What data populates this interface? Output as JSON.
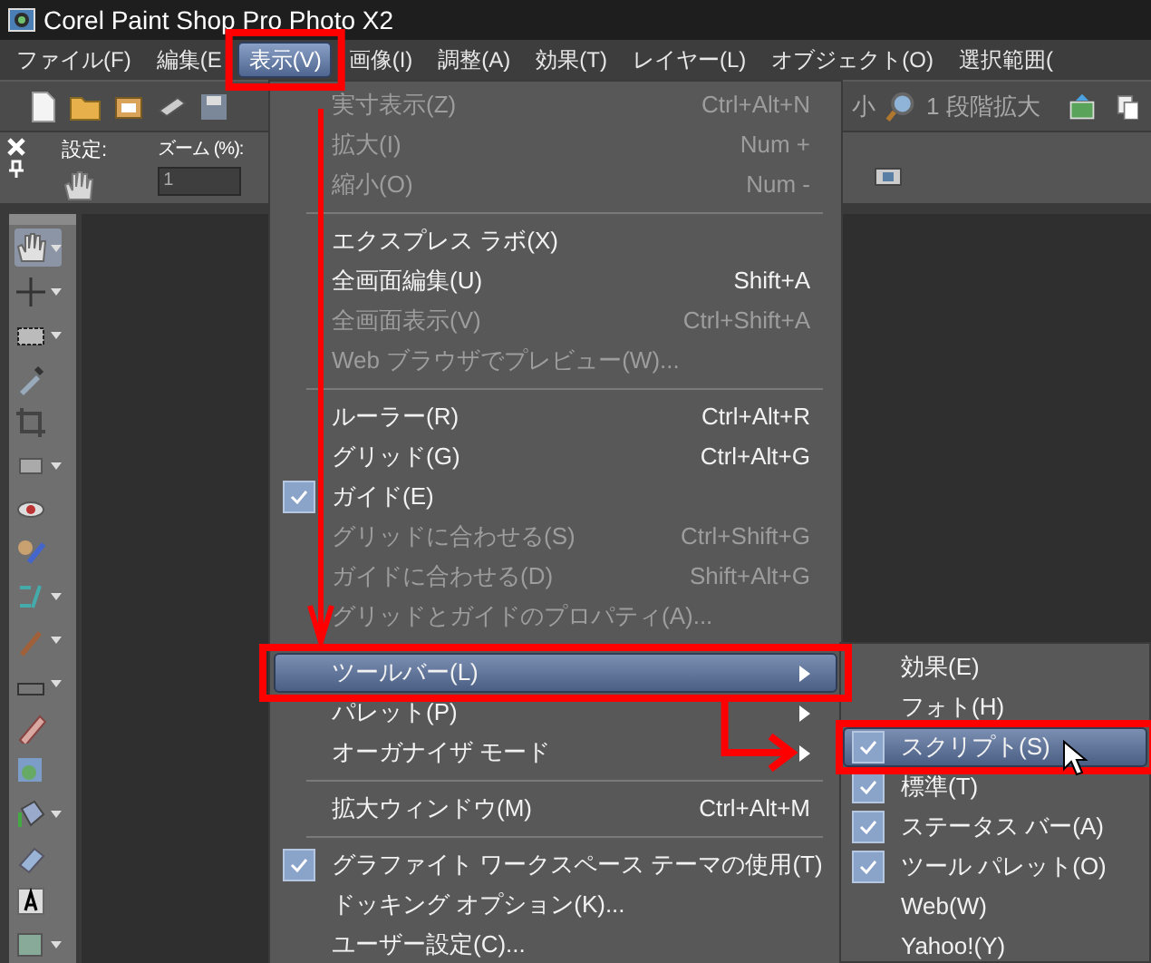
{
  "window": {
    "title": "Corel Paint Shop Pro Photo X2"
  },
  "menubar": [
    {
      "label": "ファイル(F)",
      "selected": false
    },
    {
      "label": "編集(E",
      "selected": false
    },
    {
      "label": "表示(V)",
      "selected": true
    },
    {
      "label": "画像(I)",
      "selected": false
    },
    {
      "label": "調整(A)",
      "selected": false
    },
    {
      "label": "効果(T)",
      "selected": false
    },
    {
      "label": "レイヤー(L)",
      "selected": false
    },
    {
      "label": "オブジェクト(O)",
      "selected": false
    },
    {
      "label": "選択範囲(",
      "selected": false
    }
  ],
  "toolbar": {
    "zoom_out_label": "小",
    "zoom_in_label": "1 段階拡大"
  },
  "tool_options": {
    "presets_label": "設定:",
    "zoom_label": "ズーム (%):",
    "zoom_value": "1"
  },
  "menu": [
    {
      "kind": "item",
      "label": "実寸表示(Z)",
      "shortcut": "Ctrl+Alt+N",
      "disabled": true,
      "checked": false,
      "selected": false,
      "submenu": false
    },
    {
      "kind": "item",
      "label": "拡大(I)",
      "shortcut": "Num +",
      "disabled": true,
      "checked": false,
      "selected": false,
      "submenu": false
    },
    {
      "kind": "item",
      "label": "縮小(O)",
      "shortcut": "Num -",
      "disabled": true,
      "checked": false,
      "selected": false,
      "submenu": false
    },
    {
      "kind": "separator"
    },
    {
      "kind": "item",
      "label": "エクスプレス ラボ(X)",
      "disabled": false,
      "checked": false,
      "selected": false,
      "submenu": false
    },
    {
      "kind": "item",
      "label": "全画面編集(U)",
      "shortcut": "Shift+A",
      "disabled": false,
      "checked": false,
      "selected": false,
      "submenu": false
    },
    {
      "kind": "item",
      "label": "全画面表示(V)",
      "shortcut": "Ctrl+Shift+A",
      "disabled": true,
      "checked": false,
      "selected": false,
      "submenu": false
    },
    {
      "kind": "item",
      "label": "Web ブラウザでプレビュー(W)...",
      "disabled": true,
      "checked": false,
      "selected": false,
      "submenu": false
    },
    {
      "kind": "separator"
    },
    {
      "kind": "item",
      "label": "ルーラー(R)",
      "shortcut": "Ctrl+Alt+R",
      "disabled": false,
      "checked": false,
      "selected": false,
      "submenu": false
    },
    {
      "kind": "item",
      "label": "グリッド(G)",
      "shortcut": "Ctrl+Alt+G",
      "disabled": false,
      "checked": false,
      "selected": false,
      "submenu": false
    },
    {
      "kind": "item",
      "label": "ガイド(E)",
      "disabled": false,
      "checked": true,
      "selected": false,
      "submenu": false
    },
    {
      "kind": "item",
      "label": "グリッドに合わせる(S)",
      "shortcut": "Ctrl+Shift+G",
      "disabled": true,
      "checked": false,
      "selected": false,
      "submenu": false
    },
    {
      "kind": "item",
      "label": "ガイドに合わせる(D)",
      "shortcut": "Shift+Alt+G",
      "disabled": true,
      "checked": false,
      "selected": false,
      "submenu": false
    },
    {
      "kind": "item",
      "label": "グリッドとガイドのプロパティ(A)...",
      "disabled": true,
      "checked": false,
      "selected": false,
      "submenu": false
    },
    {
      "kind": "separator"
    },
    {
      "kind": "item",
      "label": "ツールバー(L)",
      "disabled": false,
      "checked": false,
      "selected": true,
      "submenu": true
    },
    {
      "kind": "item",
      "label": "パレット(P)",
      "disabled": false,
      "checked": false,
      "selected": false,
      "submenu": true
    },
    {
      "kind": "item",
      "label": "オーガナイザ モード",
      "disabled": false,
      "checked": false,
      "selected": false,
      "submenu": true
    },
    {
      "kind": "separator"
    },
    {
      "kind": "item",
      "label": "拡大ウィンドウ(M)",
      "shortcut": "Ctrl+Alt+M",
      "disabled": false,
      "checked": false,
      "selected": false,
      "submenu": false
    },
    {
      "kind": "separator"
    },
    {
      "kind": "item",
      "label": "グラファイト ワークスペース テーマの使用(T)",
      "disabled": false,
      "checked": true,
      "selected": false,
      "submenu": false
    },
    {
      "kind": "item",
      "label": "ドッキング オプション(K)...",
      "disabled": false,
      "checked": false,
      "selected": false,
      "submenu": false
    },
    {
      "kind": "item",
      "label": "ユーザー設定(C)...",
      "disabled": false,
      "checked": false,
      "selected": false,
      "submenu": false
    }
  ],
  "submenu": [
    {
      "label": "効果(E)",
      "checked": false,
      "selected": false
    },
    {
      "label": "フォト(H)",
      "checked": false,
      "selected": false
    },
    {
      "label": "スクリプト(S)",
      "checked": true,
      "selected": true
    },
    {
      "label": "標準(T)",
      "checked": true,
      "selected": false
    },
    {
      "label": "ステータス バー(A)",
      "checked": true,
      "selected": false
    },
    {
      "label": "ツール パレット(O)",
      "checked": true,
      "selected": false
    },
    {
      "label": "Web(W)",
      "checked": false,
      "selected": false
    },
    {
      "label": "Yahoo!(Y)",
      "checked": false,
      "selected": false
    }
  ]
}
